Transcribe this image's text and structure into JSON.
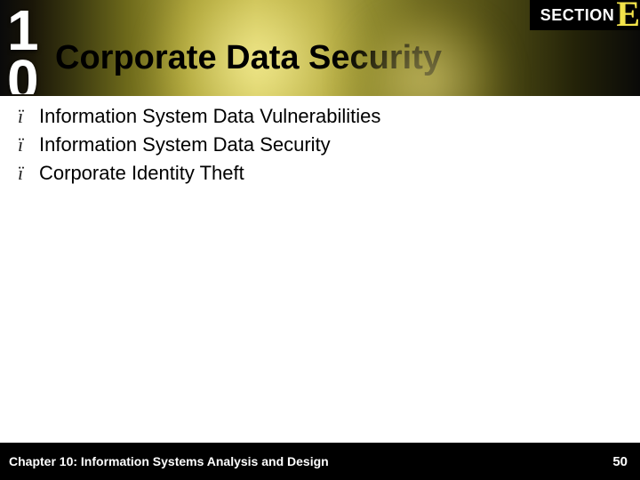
{
  "chapter_number": "10",
  "section_label": "SECTION",
  "section_letter": "E",
  "title": "Corporate Data Security",
  "bullets": [
    "Information System Data Vulnerabilities",
    "Information System Data Security",
    "Corporate Identity Theft"
  ],
  "bullet_glyph": "ï",
  "footer_text": "Chapter 10: Information Systems Analysis and Design",
  "page_number": "50"
}
